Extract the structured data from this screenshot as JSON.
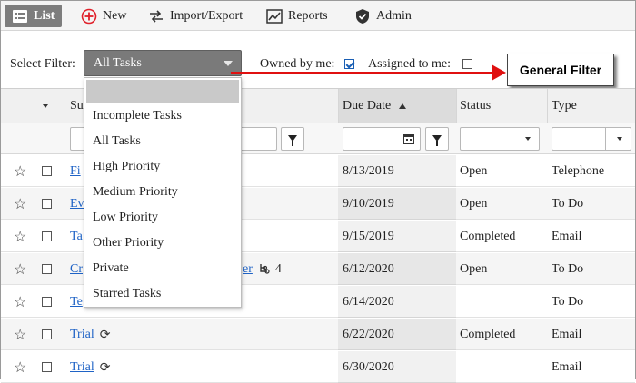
{
  "toolbar": {
    "list": "List",
    "new": "New",
    "import_export": "Import/Export",
    "reports": "Reports",
    "admin": "Admin"
  },
  "filter": {
    "label": "Select Filter:",
    "selected": "All Tasks",
    "owned_label": "Owned by me:",
    "owned_checked": true,
    "assigned_label": "Assigned to me:",
    "assigned_checked": false,
    "options": [
      "",
      "Incomplete Tasks",
      "All Tasks",
      "High Priority",
      "Medium Priority",
      "Low Priority",
      "Other Priority",
      "Private",
      "Starred Tasks"
    ]
  },
  "callout": {
    "text": "General Filter"
  },
  "grid": {
    "headers": {
      "subject": "Su",
      "due_date": "Due Date",
      "status": "Status",
      "type": "Type"
    },
    "rows": [
      {
        "subject": "Fi",
        "due": "8/13/2019",
        "status": "Open",
        "type": "Telephone"
      },
      {
        "subject": "Ev",
        "due": "9/10/2019",
        "status": "Open",
        "type": "To Do"
      },
      {
        "subject": "Ta",
        "due": "9/15/2019",
        "status": "Completed",
        "type": "Email"
      },
      {
        "subject": "Cr",
        "subject_tail": "er",
        "count": "4",
        "due": "6/12/2020",
        "status": "Open",
        "type": "To Do"
      },
      {
        "subject": "Te",
        "due": "6/14/2020",
        "status": "",
        "type": "To Do"
      },
      {
        "subject": "Trial",
        "due": "6/22/2020",
        "status": "Completed",
        "type": "Email"
      },
      {
        "subject": "Trial",
        "due": "6/30/2020",
        "status": "",
        "type": "Email"
      }
    ]
  },
  "colors": {
    "accent_red": "#e01010",
    "link_blue": "#1f63c6",
    "select_gray": "#7a7a7a"
  }
}
